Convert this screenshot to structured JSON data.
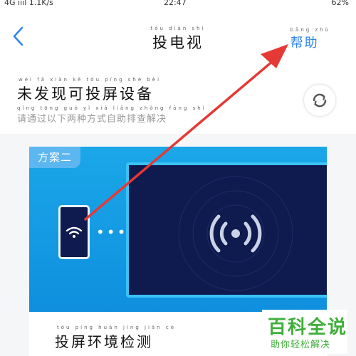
{
  "statusbar": {
    "signal": "4G ıııl 1.1K/s",
    "time": "22:47",
    "battery": "62%"
  },
  "header": {
    "title": "投电视",
    "title_pinyin": "tóu diàn shì",
    "help": "帮助",
    "help_pinyin": "bāng zhù"
  },
  "no_device": {
    "title": "未发现可投屏设备",
    "title_pinyin": "wèi fā xiàn kě tóu píng shè bèi",
    "subtitle": "请通过以下两种方式自助排查解决",
    "subtitle_pinyin": "qǐng tōng guò yǐ xià liǎng zhǒng fāng shì zì zhù pái chá jiě jué"
  },
  "plan": {
    "badge": "方案二",
    "dots": "•••",
    "env_title": "投屏环境检测",
    "env_pinyin": "tóu píng huán jìng jiǎn cè"
  },
  "watermark": {
    "line1": "百科全说",
    "line2": "助你轻松解决"
  },
  "colors": {
    "accent": "#2f86e8",
    "arrow": "#e53935",
    "illus": "#1aa7e8",
    "tv_screen": "#0f1a4e",
    "watermark": "#3fae3a"
  },
  "icons": [
    "back-arrow-icon",
    "refresh-icon",
    "wifi-icon",
    "cast-signal-icon"
  ]
}
